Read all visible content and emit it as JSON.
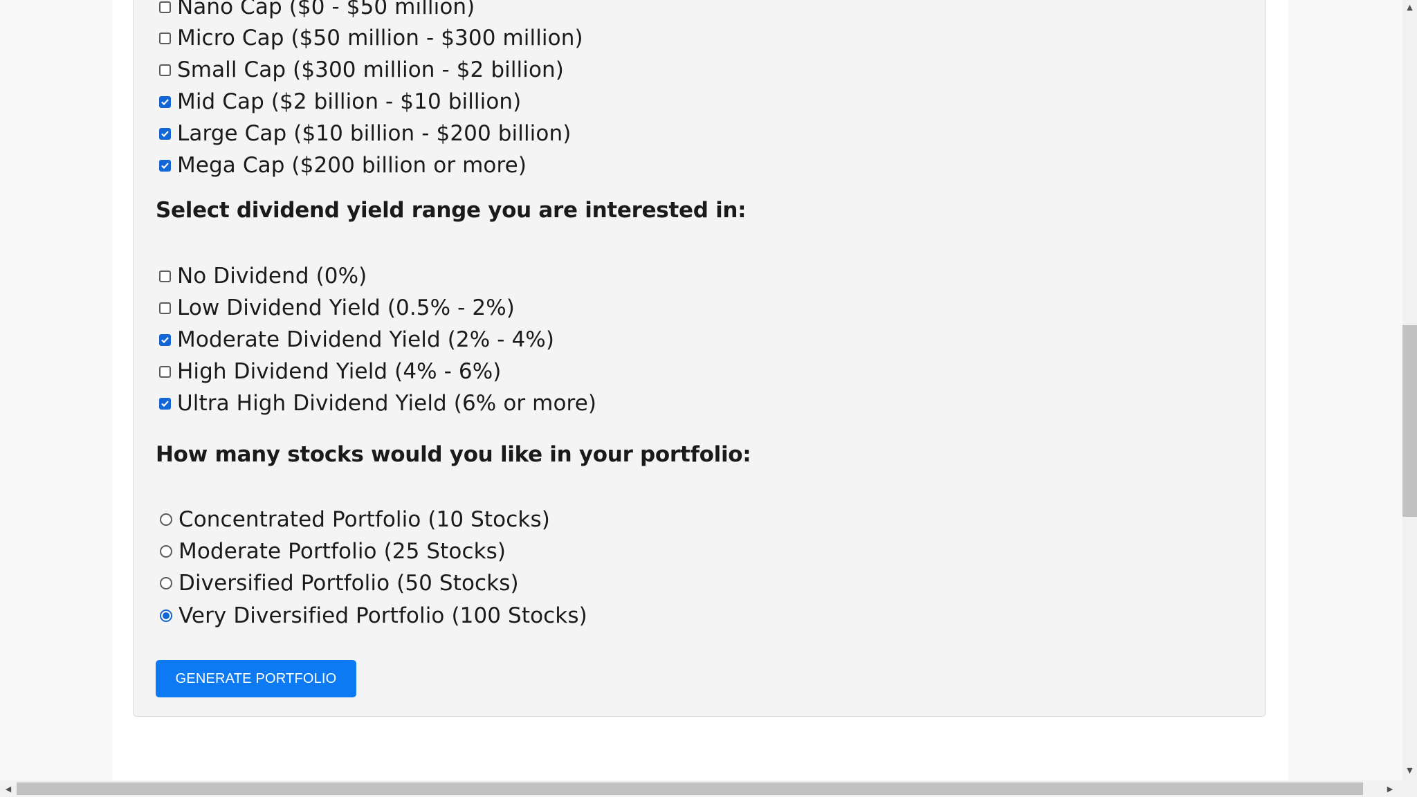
{
  "market_cap": {
    "options": [
      {
        "label": "Nano Cap ($0 - $50 million)",
        "checked": false
      },
      {
        "label": "Micro Cap ($50 million - $300 million)",
        "checked": false
      },
      {
        "label": "Small Cap ($300 million - $2 billion)",
        "checked": false
      },
      {
        "label": "Mid Cap ($2 billion - $10 billion)",
        "checked": true
      },
      {
        "label": "Large Cap ($10 billion - $200 billion)",
        "checked": true
      },
      {
        "label": "Mega Cap ($200 billion or more)",
        "checked": true
      }
    ]
  },
  "dividend": {
    "heading": "Select dividend yield range you are interested in:",
    "options": [
      {
        "label": "No Dividend (0%)",
        "checked": false
      },
      {
        "label": "Low Dividend Yield (0.5% - 2%)",
        "checked": false
      },
      {
        "label": "Moderate Dividend Yield (2% - 4%)",
        "checked": true
      },
      {
        "label": "High Dividend Yield (4% - 6%)",
        "checked": false
      },
      {
        "label": "Ultra High Dividend Yield (6% or more)",
        "checked": true
      }
    ]
  },
  "portfolio_size": {
    "heading": "How many stocks would you like in your portfolio:",
    "options": [
      {
        "label": "Concentrated Portfolio (10 Stocks)",
        "selected": false
      },
      {
        "label": "Moderate Portfolio (25 Stocks)",
        "selected": false
      },
      {
        "label": "Diversified Portfolio (50 Stocks)",
        "selected": false
      },
      {
        "label": "Very Diversified Portfolio (100 Stocks)",
        "selected": true
      }
    ]
  },
  "generate_button": {
    "label": "GENERATE PORTFOLIO"
  },
  "colors": {
    "accent": "#1266d6",
    "button": "#0d79f2",
    "card_bg": "#f4f4f4",
    "page_bg": "#f8f8f8"
  },
  "scrollbars": {
    "vertical": {
      "up_icon": "triangle-up-icon",
      "down_icon": "triangle-down-icon"
    },
    "horizontal": {
      "left_icon": "triangle-left-icon",
      "right_icon": "triangle-right-icon"
    }
  }
}
